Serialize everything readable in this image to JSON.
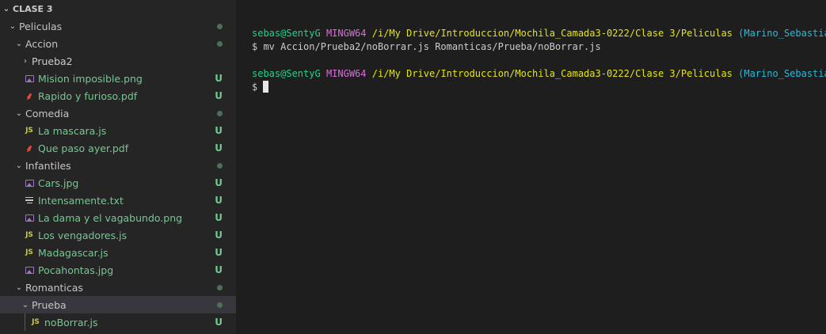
{
  "explorer": {
    "root": "CLASE 3",
    "peliculas": "Peliculas",
    "accion": {
      "name": "Accion",
      "prueba2": "Prueba2",
      "files": [
        {
          "name": "Mision imposible.png",
          "status": "U"
        },
        {
          "name": "Rapido y furioso.pdf",
          "status": "U"
        }
      ]
    },
    "comedia": {
      "name": "Comedia",
      "files": [
        {
          "name": "La mascara.js",
          "status": "U"
        },
        {
          "name": "Que paso ayer.pdf",
          "status": "U"
        }
      ]
    },
    "infantiles": {
      "name": "Infantiles",
      "files": [
        {
          "name": "Cars.jpg",
          "status": "U"
        },
        {
          "name": "Intensamente.txt",
          "status": "U"
        },
        {
          "name": "La dama y el vagabundo.png",
          "status": "U"
        },
        {
          "name": "Los vengadores.js",
          "status": "U"
        },
        {
          "name": "Madagascar.js",
          "status": "U"
        },
        {
          "name": "Pocahontas.jpg",
          "status": "U"
        }
      ]
    },
    "romanticas": {
      "name": "Romanticas",
      "prueba": "Prueba",
      "files": [
        {
          "name": "noBorrar.js",
          "status": "U"
        }
      ]
    },
    "js_icon": "JS"
  },
  "terminal": {
    "prompt1": {
      "user": "sebas@SentyG",
      "host": "MINGW64",
      "path": "/i/My Drive/Introduccion/Mochila_Camada3-0222/Clase 3/Peliculas",
      "branch": "(Marino_Sebastian)"
    },
    "cmd1": "$ mv Accion/Prueba2/noBorrar.js Romanticas/Prueba/noBorrar.js",
    "prompt2": {
      "user": "sebas@SentyG",
      "host": "MINGW64",
      "path": "/i/My Drive/Introduccion/Mochila_Camada3-0222/Clase 3/Peliculas",
      "branch": "(Marino_Sebastian)"
    },
    "cmd2": "$ "
  },
  "colors": {
    "modified_green": "#73c991",
    "user_green": "#23d18b",
    "host_magenta": "#d670d6",
    "path_yellow": "#e5e510",
    "branch_cyan": "#29b8db"
  }
}
